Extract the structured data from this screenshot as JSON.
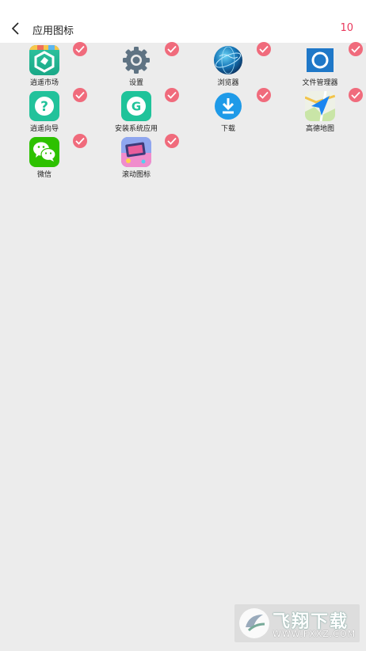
{
  "header": {
    "title": "应用图标",
    "count": "10",
    "back_icon": "back-chevron-icon"
  },
  "apps": [
    {
      "label": "逍遥市场",
      "icon": "xiaoyao-market-icon",
      "selected": true
    },
    {
      "label": "设置",
      "icon": "settings-gear-icon",
      "selected": true
    },
    {
      "label": "浏览器",
      "icon": "browser-globe-icon",
      "selected": true
    },
    {
      "label": "文件管理器",
      "icon": "file-manager-icon",
      "selected": true
    },
    {
      "label": "逍遥向导",
      "icon": "xiaoyao-guide-icon",
      "selected": true
    },
    {
      "label": "安装系统应用",
      "icon": "install-system-app-icon",
      "selected": true
    },
    {
      "label": "下载",
      "icon": "download-icon",
      "selected": true
    },
    {
      "label": "高德地图",
      "icon": "amap-icon",
      "selected": true
    },
    {
      "label": "微信",
      "icon": "wechat-icon",
      "selected": true
    },
    {
      "label": "滚动图标",
      "icon": "scroll-icon-icon",
      "selected": true
    }
  ],
  "watermark": {
    "brand": "飞翔下载",
    "url": "WWW.FXXZ.COM"
  },
  "colors": {
    "accent": "#e9385c",
    "check": "#f06b7c",
    "background": "#ececec"
  }
}
